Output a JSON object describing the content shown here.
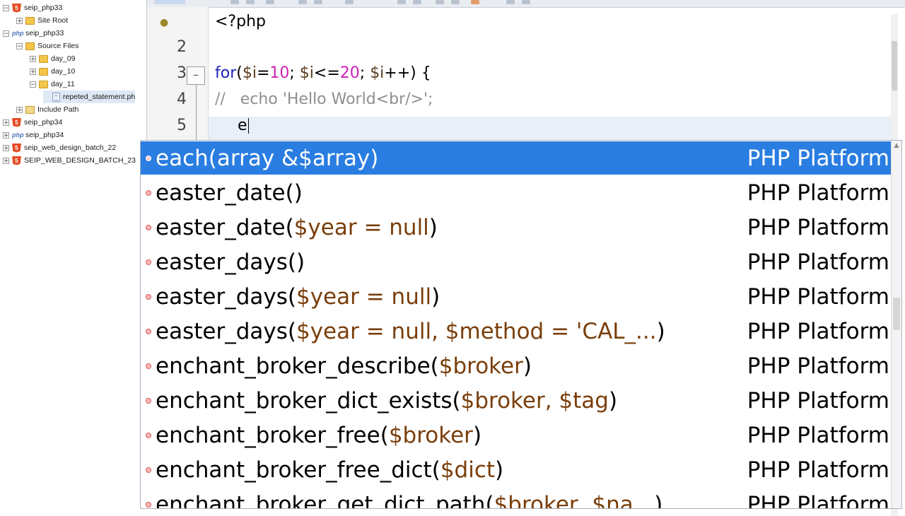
{
  "project_tree": {
    "items": [
      {
        "label": "seip_php33",
        "indent": 0,
        "toggle": "-",
        "icon": "html5-icon"
      },
      {
        "label": "Site Root",
        "indent": 1,
        "toggle": "+",
        "icon": "folder-icon"
      },
      {
        "label": "seip_php33",
        "indent": 0,
        "toggle": "-",
        "icon": "php-project-icon"
      },
      {
        "label": "Source Files",
        "indent": 1,
        "toggle": "-",
        "icon": "folder-icon"
      },
      {
        "label": "day_09",
        "indent": 2,
        "toggle": "+",
        "icon": "folder-icon"
      },
      {
        "label": "day_10",
        "indent": 2,
        "toggle": "+",
        "icon": "folder-icon"
      },
      {
        "label": "day_11",
        "indent": 2,
        "toggle": "-",
        "icon": "folder-icon"
      },
      {
        "label": "repeted_statement.ph",
        "indent": 3,
        "toggle": "",
        "icon": "php-file-icon",
        "selected": true
      },
      {
        "label": "Include Path",
        "indent": 1,
        "toggle": "+",
        "icon": "library-icon"
      },
      {
        "label": "seip_php34",
        "indent": 0,
        "toggle": "+",
        "icon": "html5-icon"
      },
      {
        "label": "seip_php34",
        "indent": 0,
        "toggle": "+",
        "icon": "php-project-icon"
      },
      {
        "label": "seip_web_design_batch_22",
        "indent": 0,
        "toggle": "+",
        "icon": "html5-icon"
      },
      {
        "label": "SEIP_WEB_DESIGN_BATCH_23",
        "indent": 0,
        "toggle": "+",
        "icon": "html5-icon"
      }
    ]
  },
  "editor": {
    "line_numbers": [
      "2",
      "3",
      "4",
      "5"
    ],
    "code": {
      "line1": "<?php",
      "line3": {
        "kw": "for",
        "p1": "(",
        "v1": "$i",
        "eq1": "=",
        "n1": "10",
        "semi1": "; ",
        "v2": "$i",
        "le": "<=",
        "n2": "20",
        "semi2": "; ",
        "v3": "$i",
        "inc": "++) {"
      },
      "line4": "//   echo 'Hello World<br/>';",
      "line5": "e"
    }
  },
  "completion": {
    "items": [
      {
        "name": "each",
        "args": "array &$array",
        "source": "PHP Platform",
        "selected": true
      },
      {
        "name": "easter_date",
        "args": "",
        "source": "PHP Platform"
      },
      {
        "name": "easter_date",
        "args": "$year = null",
        "source": "PHP Platform"
      },
      {
        "name": "easter_days",
        "args": "",
        "source": "PHP Platform"
      },
      {
        "name": "easter_days",
        "args": "$year = null",
        "source": "PHP Platform"
      },
      {
        "name": "easter_days",
        "args": "$year = null, $method = 'CAL_...",
        "source": "PHP Platform"
      },
      {
        "name": "enchant_broker_describe",
        "args": "$broker",
        "source": "PHP Platform"
      },
      {
        "name": "enchant_broker_dict_exists",
        "args": "$broker, $tag",
        "source": "PHP Platform"
      },
      {
        "name": "enchant_broker_free",
        "args": "$broker",
        "source": "PHP Platform"
      },
      {
        "name": "enchant_broker_free_dict",
        "args": "$dict",
        "source": "PHP Platform"
      },
      {
        "name": "enchant_broker_get_dict_path",
        "args": "$broker, $na...",
        "source": "PHP Platform"
      }
    ]
  },
  "colors": {
    "selection": "#2a7de1",
    "keyword": "#2020b8",
    "number": "#d01fb4",
    "parameter": "#7a3e0a",
    "comment": "#8f8f8f"
  }
}
